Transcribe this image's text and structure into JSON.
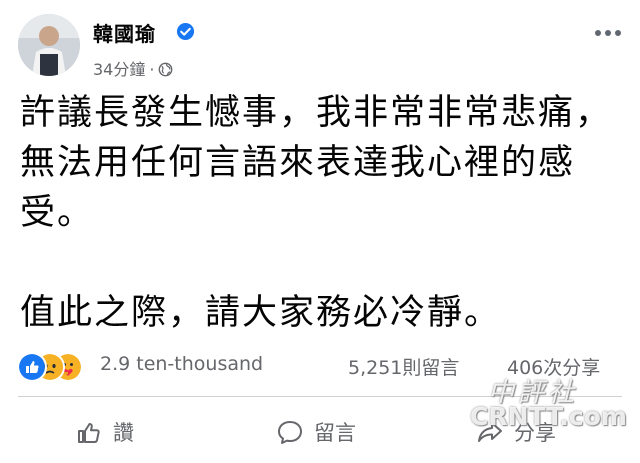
{
  "author": {
    "name": "韓國瑜",
    "verified_icon": "verified-badge-icon",
    "timestamp": "34分鐘",
    "separator": "·",
    "privacy_icon": "globe-icon"
  },
  "post": {
    "paragraph_1": "許議長發生憾事，我非常非常悲痛，無法用任何言語來表達我心裡的感受。",
    "paragraph_2": "值此之際，請大家務必冷靜。"
  },
  "stats": {
    "reaction_icons": [
      "like-icon",
      "sad-icon",
      "care-icon"
    ],
    "reaction_count": "2.9 ten-thousand",
    "comments": "5,251則留言",
    "shares": "406次分享"
  },
  "actions": {
    "like_label": "讚",
    "comment_label": "留言",
    "share_label": "分享"
  },
  "watermark": {
    "cn": "中評社",
    "en": "CRNTT.com"
  },
  "colors": {
    "text": "#050505",
    "secondary": "#65676b",
    "like_blue": "#1877f2",
    "sad_yellow": "#f7b125",
    "divider": "#ced0d4"
  }
}
